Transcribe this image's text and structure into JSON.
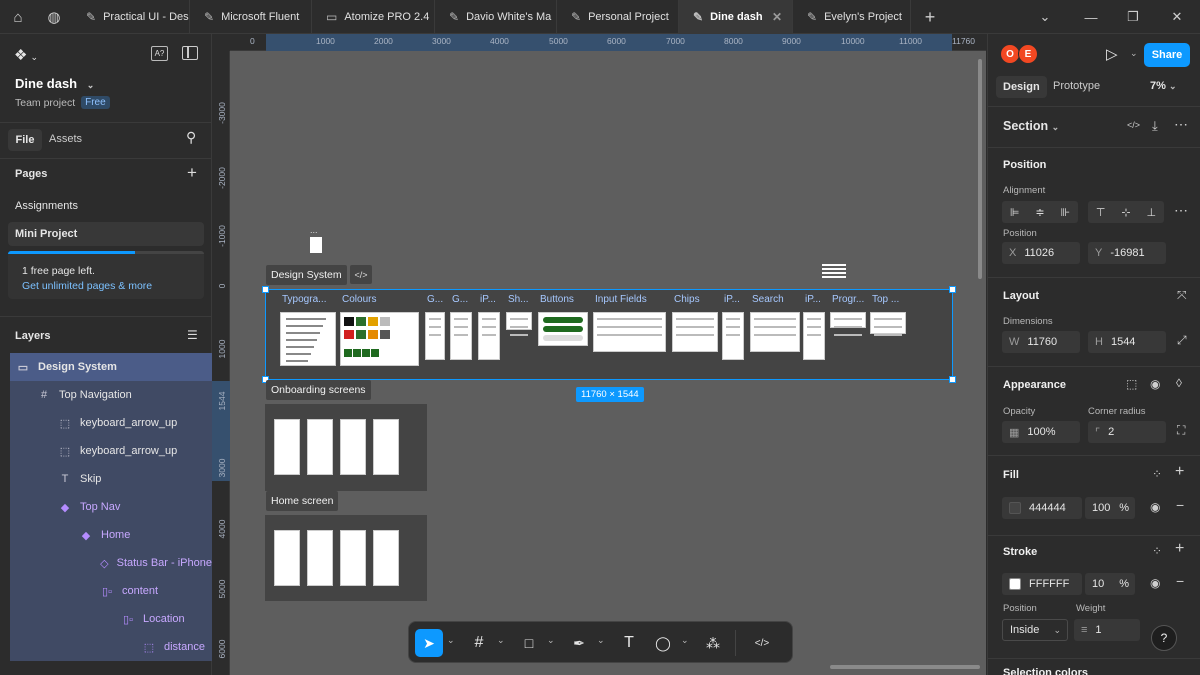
{
  "tabs": [
    {
      "label": "Practical UI - Des",
      "icon": "pen-icon",
      "active": false
    },
    {
      "label": "Microsoft Fluent",
      "icon": "pen-icon",
      "active": false
    },
    {
      "label": "Atomize PRO 2.4",
      "icon": "book-icon",
      "active": false
    },
    {
      "label": "Davio White's Ma",
      "icon": "pen-icon",
      "active": false
    },
    {
      "label": "Personal Project",
      "icon": "pen-icon",
      "active": false
    },
    {
      "label": "Dine dash",
      "icon": "pen-icon",
      "active": true
    },
    {
      "label": "Evelyn's Project",
      "icon": "pen-icon",
      "active": false
    }
  ],
  "file": {
    "name": "Dine dash",
    "team": "Team project",
    "plan": "Free"
  },
  "left_tabs": {
    "file": "File",
    "assets": "Assets"
  },
  "pages": {
    "title": "Pages",
    "items": [
      {
        "label": "Assignments",
        "selected": false
      },
      {
        "label": "Mini Project",
        "selected": true
      }
    ]
  },
  "upsell": {
    "text": "1 free page left.",
    "link": "Get unlimited pages & more",
    "progress": 0.65
  },
  "layers": {
    "title": "Layers",
    "items": [
      {
        "label": "Design System",
        "icon": "section-icon",
        "depth": 0,
        "purple": false
      },
      {
        "label": "Top Navigation",
        "icon": "frame-icon",
        "depth": 1,
        "purple": false
      },
      {
        "label": "keyboard_arrow_up",
        "icon": "dashed-frame-icon",
        "depth": 2,
        "purple": false
      },
      {
        "label": "keyboard_arrow_up",
        "icon": "dashed-frame-icon",
        "depth": 2,
        "purple": false
      },
      {
        "label": "Skip",
        "icon": "text-icon",
        "depth": 2,
        "purple": false
      },
      {
        "label": "Top Nav",
        "icon": "component-icon",
        "depth": 2,
        "purple": true
      },
      {
        "label": "Home",
        "icon": "component-icon",
        "depth": 3,
        "purple": true
      },
      {
        "label": "Status Bar - iPhone",
        "icon": "instance-icon",
        "depth": 4,
        "purple": true
      },
      {
        "label": "content",
        "icon": "autolayout-icon",
        "depth": 4,
        "purple": true
      },
      {
        "label": "Location",
        "icon": "autolayout-icon",
        "depth": 5,
        "purple": true
      },
      {
        "label": "distance",
        "icon": "dashed-frame-icon",
        "depth": 6,
        "purple": true
      }
    ]
  },
  "ruler": {
    "h": [
      "0",
      "1000",
      "2000",
      "3000",
      "4000",
      "5000",
      "6000",
      "7000",
      "8000",
      "9000",
      "10000",
      "11000",
      "11760"
    ],
    "v": [
      "-3000",
      "-2000",
      "-1000",
      "0",
      "1000",
      "1544",
      "3000",
      "4000",
      "5000",
      "6000"
    ]
  },
  "canvas": {
    "design_system": "Design System",
    "onboarding": "Onboarding screens",
    "home": "Home screen",
    "size_badge": "11760 × 1544",
    "mini_frames": [
      "Typogra...",
      "Colours",
      "G...",
      "G...",
      "iP...",
      "Sh...",
      "Buttons",
      "Input Fields",
      "Chips",
      "iP...",
      "Search",
      "iP...",
      "Progr...",
      "Top ..."
    ],
    "small_text": "..."
  },
  "right": {
    "tabs": {
      "design": "Design",
      "prototype": "Prototype"
    },
    "zoom": "7%",
    "share": "Share",
    "avatars": [
      {
        "letter": "O",
        "color": "#f24822"
      },
      {
        "letter": "E",
        "color": "#f24822"
      }
    ],
    "section_title": "Section",
    "position": {
      "title": "Position",
      "alignment": "Alignment",
      "position_label": "Position",
      "x_label": "X",
      "x": "11026",
      "y_label": "Y",
      "y": "-16981"
    },
    "layout": {
      "title": "Layout",
      "dimensions": "Dimensions",
      "w_label": "W",
      "w": "11760",
      "h_label": "H",
      "h": "1544"
    },
    "appearance": {
      "title": "Appearance",
      "opacity_label": "Opacity",
      "opacity": "100%",
      "radius_label": "Corner radius",
      "radius": "2"
    },
    "fill": {
      "title": "Fill",
      "hex": "444444",
      "opacity": "100",
      "pct": "%",
      "color": "#444444"
    },
    "stroke": {
      "title": "Stroke",
      "hex": "FFFFFF",
      "opacity": "10",
      "pct": "%",
      "position_label": "Position",
      "position": "Inside",
      "weight_label": "Weight",
      "weight": "1"
    },
    "selection_colors": "Selection colors"
  },
  "help": "?"
}
